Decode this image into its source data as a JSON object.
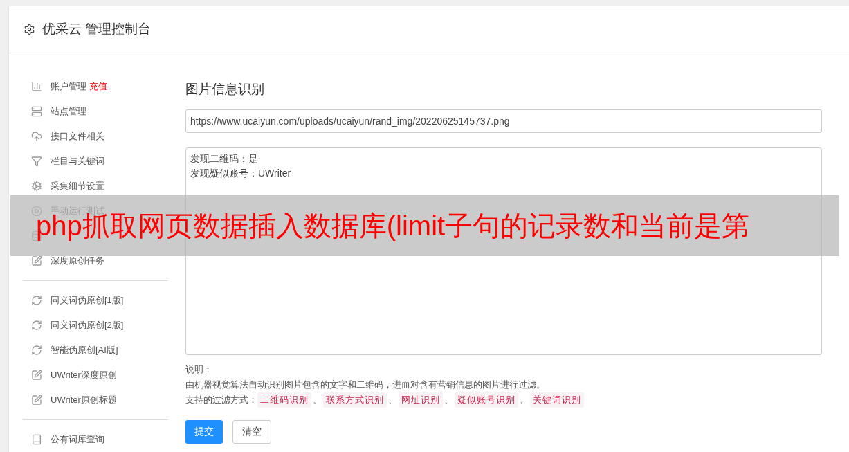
{
  "header": {
    "title": "优采云 管理控制台"
  },
  "sidebar": {
    "groups": [
      [
        {
          "kind": "chart",
          "label": "账户管理",
          "badge": "充值"
        },
        {
          "kind": "server",
          "label": "站点管理"
        },
        {
          "kind": "upload",
          "label": "接口文件相关"
        },
        {
          "kind": "filter",
          "label": "栏目与关键词"
        },
        {
          "kind": "cog",
          "label": "采集细节设置"
        },
        {
          "kind": "play",
          "label": "手动运行测试"
        },
        {
          "kind": "database"
        },
        {
          "kind": "edit",
          "label": "深度原创任务"
        }
      ],
      [
        {
          "kind": "refresh",
          "label": "同义词伪原创[1版]"
        },
        {
          "kind": "refresh",
          "label": "同义词伪原创[2版]"
        },
        {
          "kind": "refresh",
          "label": "智能伪原创[AI版]"
        },
        {
          "kind": "edit",
          "label": "UWriter深度原创"
        },
        {
          "kind": "edit",
          "label": "UWriter原创标题"
        }
      ],
      [
        {
          "kind": "book",
          "label": "公有词库查询"
        }
      ]
    ]
  },
  "main": {
    "title": "图片信息识别",
    "url_field": {
      "value": "https://www.ucaiyun.com/uploads/ucaiyun/rand_img/20220625145737.png"
    },
    "result_area": {
      "lines": [
        "发现二维码：是",
        "发现疑似账号：UWriter"
      ]
    },
    "notes_title": "说明：",
    "description": "由机器视觉算法自动识别图片包含的文字和二维码，进而对含有营销信息的图片进行过滤。",
    "filters_label": "支持的过滤方式：",
    "separator": "、",
    "filters": [
      "二维码识别",
      "联系方式识别",
      "网址识别",
      "疑似账号识别",
      "关键词识别"
    ],
    "buttons": [
      {
        "label": "提交",
        "kind": "primary"
      },
      {
        "label": "清空",
        "kind": "default"
      }
    ]
  },
  "overlay_banner": {
    "text": "php抓取网页数据插入数据库(limit子句的记录数和当前是第"
  }
}
